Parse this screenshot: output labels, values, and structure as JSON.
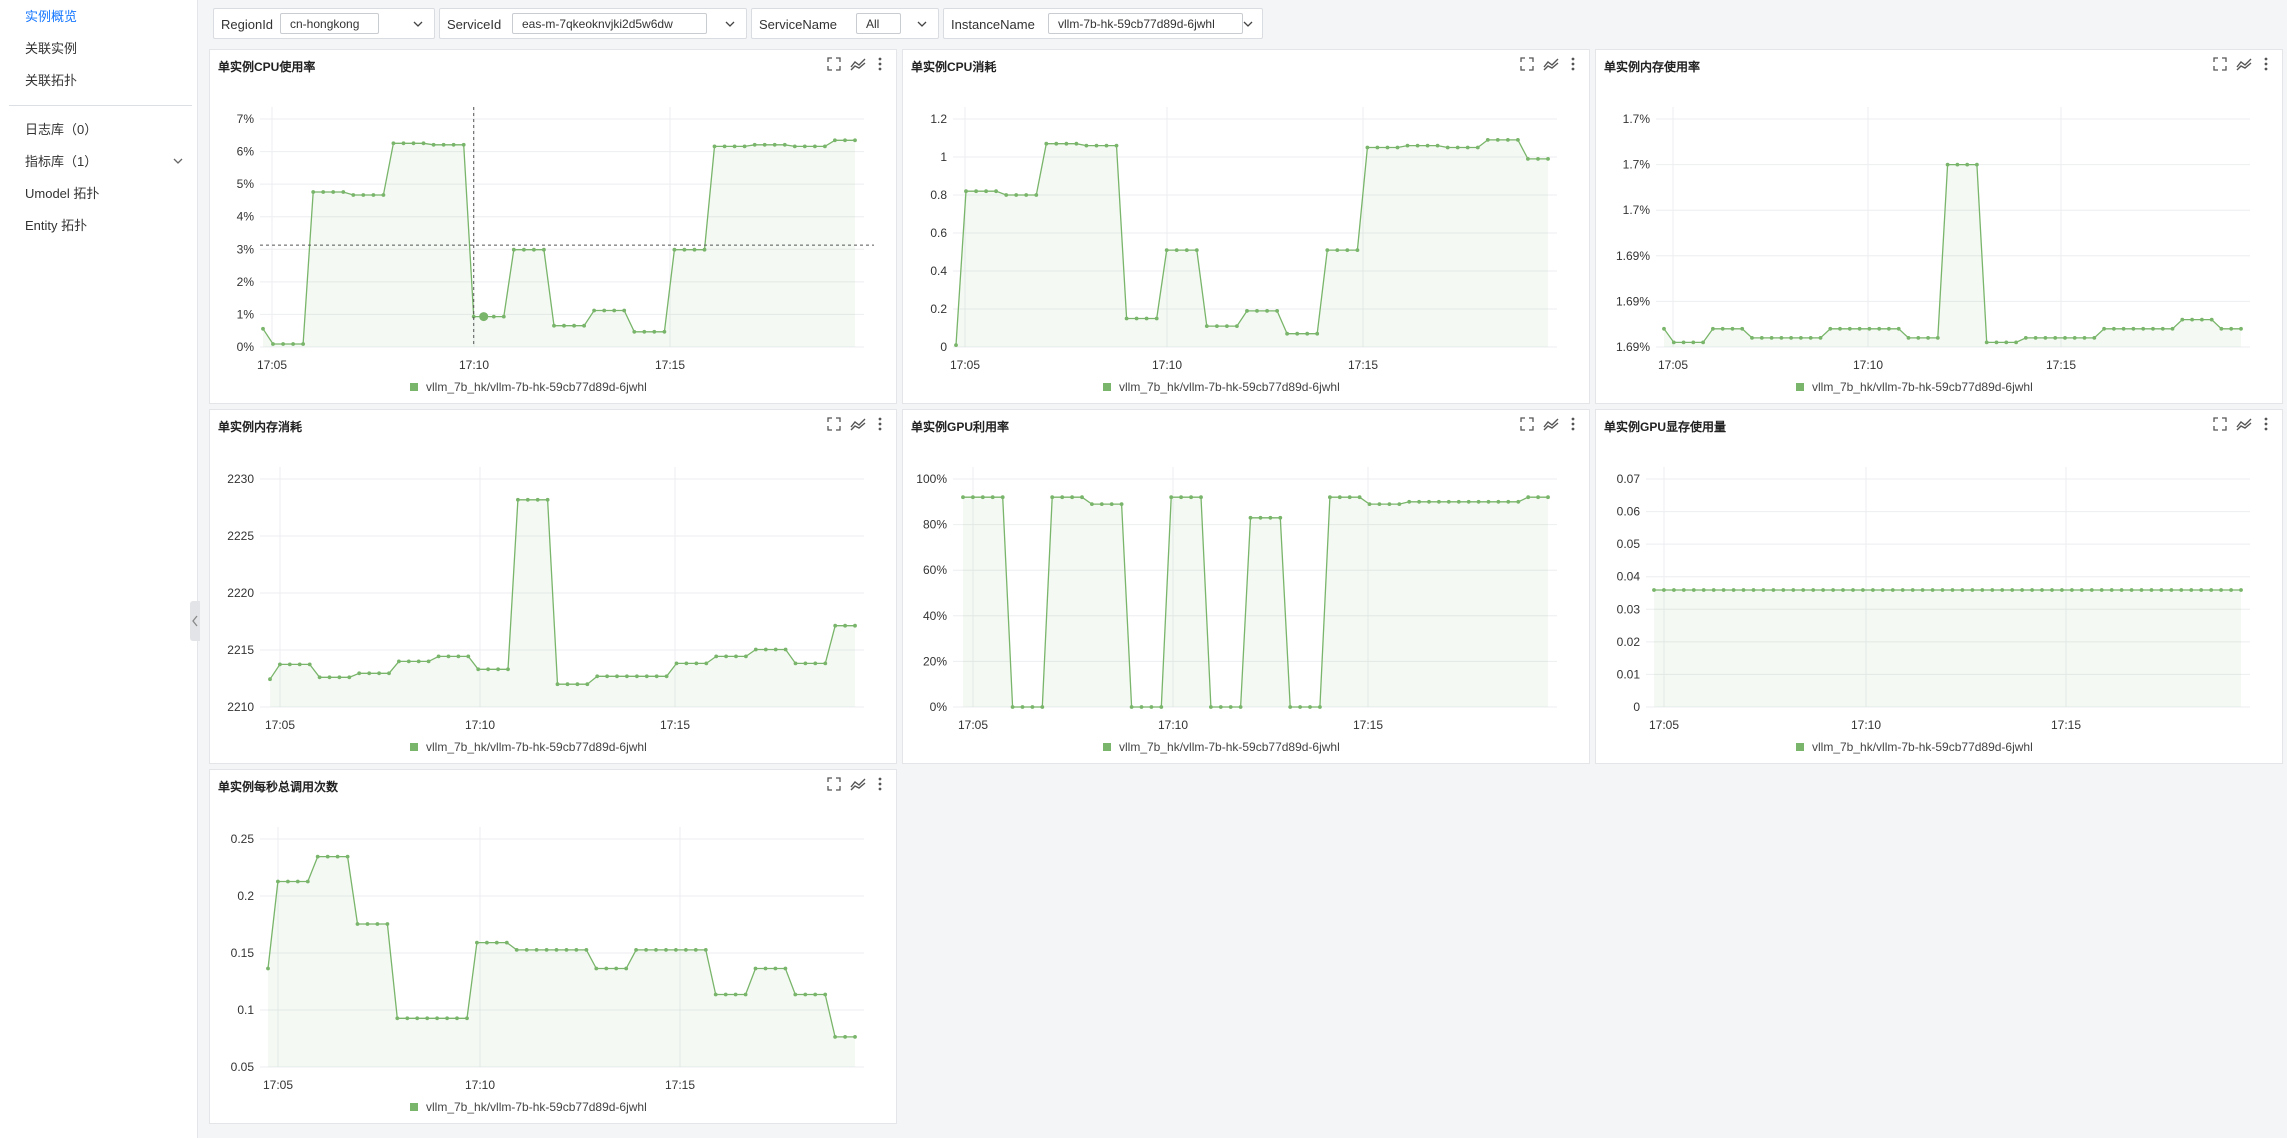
{
  "sidebar": {
    "items": [
      {
        "label": "实例概览",
        "active": true
      },
      {
        "label": "关联实例"
      },
      {
        "label": "关联拓扑"
      },
      {
        "label": "日志库（0）"
      },
      {
        "label": "指标库（1）",
        "expandable": true
      },
      {
        "label": "Umodel 拓扑"
      },
      {
        "label": "Entity 拓扑"
      }
    ]
  },
  "filters": {
    "region": {
      "label": "RegionId",
      "value": "cn-hongkong"
    },
    "service": {
      "label": "ServiceId",
      "value": "eas-m-7qkeoknvjki2d5w6dw"
    },
    "service_name": {
      "label": "ServiceName",
      "value": "All"
    },
    "instance": {
      "label": "InstanceName",
      "value": "vllm-7b-hk-59cb77d89d-6jwhl"
    }
  },
  "colors": {
    "series": "#79b56a",
    "accent": "#1677ff"
  },
  "icons": [
    "fullscreen-icon",
    "trend-icon",
    "more-icon",
    "chevron-down-icon",
    "collapse-left-icon"
  ],
  "panels": [
    {
      "title": "单实例CPU使用率",
      "legend": "vllm_7b_hk/vllm-7b-hk-59cb77d89d-6jwhl",
      "chart_data": {
        "type": "area",
        "y_ticks": [
          "0%",
          "1%",
          "2%",
          "3%",
          "4%",
          "5%",
          "6%",
          "7%"
        ],
        "x_ticks": [
          "17:05",
          "17:10",
          "17:15"
        ],
        "ylim": [
          0,
          7.5
        ],
        "y": [
          0.6,
          0.1,
          0.1,
          0.1,
          0.1,
          5.1,
          5.1,
          5.1,
          5.1,
          5.0,
          5.0,
          5.0,
          5.0,
          6.7,
          6.7,
          6.7,
          6.7,
          6.65,
          6.65,
          6.65,
          6.65,
          1.0,
          1.0,
          1.0,
          1.0,
          3.2,
          3.2,
          3.2,
          3.2,
          0.7,
          0.7,
          0.7,
          0.7,
          1.2,
          1.2,
          1.2,
          1.2,
          0.5,
          0.5,
          0.5,
          0.5,
          3.2,
          3.2,
          3.2,
          3.2,
          6.6,
          6.6,
          6.6,
          6.6,
          6.65,
          6.65,
          6.65,
          6.65,
          6.6,
          6.6,
          6.6,
          6.6,
          6.8,
          6.8,
          6.8
        ],
        "crosshair": {
          "index": 21,
          "y": 3.35
        }
      }
    },
    {
      "title": "单实例CPU消耗",
      "legend": "vllm_7b_hk/vllm-7b-hk-59cb77d89d-6jwhl",
      "chart_data": {
        "type": "area",
        "y_ticks": [
          "0",
          "0.2",
          "0.4",
          "0.6",
          "0.8",
          "1",
          "1.2"
        ],
        "x_ticks": [
          "17:05",
          "17:10",
          "17:15"
        ],
        "ylim": [
          0,
          1.2
        ],
        "y": [
          0.01,
          0.82,
          0.82,
          0.82,
          0.82,
          0.8,
          0.8,
          0.8,
          0.8,
          1.07,
          1.07,
          1.07,
          1.07,
          1.06,
          1.06,
          1.06,
          1.06,
          0.15,
          0.15,
          0.15,
          0.15,
          0.51,
          0.51,
          0.51,
          0.51,
          0.11,
          0.11,
          0.11,
          0.11,
          0.19,
          0.19,
          0.19,
          0.19,
          0.07,
          0.07,
          0.07,
          0.07,
          0.51,
          0.51,
          0.51,
          0.51,
          1.05,
          1.05,
          1.05,
          1.05,
          1.06,
          1.06,
          1.06,
          1.06,
          1.05,
          1.05,
          1.05,
          1.05,
          1.09,
          1.09,
          1.09,
          1.09,
          0.99,
          0.99,
          0.99
        ]
      }
    },
    {
      "title": "单实例内存使用率",
      "legend": "vllm_7b_hk/vllm-7b-hk-59cb77d89d-6jwhl",
      "chart_data": {
        "type": "area",
        "y_ticks": [
          "1.69%",
          "1.69%",
          "1.69%",
          "1.7%",
          "1.7%",
          "1.7%"
        ],
        "x_ticks": [
          "17:05",
          "17:10",
          "17:15"
        ],
        "ylim": [
          0,
          5
        ],
        "y": [
          0.4,
          0.1,
          0.1,
          0.1,
          0.1,
          0.4,
          0.4,
          0.4,
          0.4,
          0.2,
          0.2,
          0.2,
          0.2,
          0.2,
          0.2,
          0.2,
          0.2,
          0.4,
          0.4,
          0.4,
          0.4,
          0.4,
          0.4,
          0.4,
          0.4,
          0.2,
          0.2,
          0.2,
          0.2,
          4.0,
          4.0,
          4.0,
          4.0,
          0.1,
          0.1,
          0.1,
          0.1,
          0.2,
          0.2,
          0.2,
          0.2,
          0.2,
          0.2,
          0.2,
          0.2,
          0.4,
          0.4,
          0.4,
          0.4,
          0.4,
          0.4,
          0.4,
          0.4,
          0.6,
          0.6,
          0.6,
          0.6,
          0.4,
          0.4,
          0.4
        ]
      }
    },
    {
      "title": "单实例内存消耗",
      "legend": "vllm_7b_hk/vllm-7b-hk-59cb77d89d-6jwhl",
      "chart_data": {
        "type": "area",
        "y_ticks": [
          "2210",
          "2215",
          "2220",
          "2225",
          "2230"
        ],
        "x_ticks": [
          "17:05",
          "17:10",
          "17:15"
        ],
        "ylim": [
          2208,
          2231
        ],
        "y": [
          2210.8,
          2212.3,
          2212.3,
          2212.3,
          2212.3,
          2211.0,
          2211.0,
          2211.0,
          2211.0,
          2211.4,
          2211.4,
          2211.4,
          2211.4,
          2212.6,
          2212.6,
          2212.6,
          2212.6,
          2213.1,
          2213.1,
          2213.1,
          2213.1,
          2211.8,
          2211.8,
          2211.8,
          2211.8,
          2228.9,
          2228.9,
          2228.9,
          2228.9,
          2210.3,
          2210.3,
          2210.3,
          2210.3,
          2211.1,
          2211.1,
          2211.1,
          2211.1,
          2211.1,
          2211.1,
          2211.1,
          2211.1,
          2212.4,
          2212.4,
          2212.4,
          2212.4,
          2213.1,
          2213.1,
          2213.1,
          2213.1,
          2213.8,
          2213.8,
          2213.8,
          2213.8,
          2212.4,
          2212.4,
          2212.4,
          2212.4,
          2216.2,
          2216.2,
          2216.2
        ]
      }
    },
    {
      "title": "单实例GPU利用率",
      "legend": "vllm_7b_hk/vllm-7b-hk-59cb77d89d-6jwhl",
      "chart_data": {
        "type": "area",
        "y_ticks": [
          "0%",
          "20%",
          "40%",
          "60%",
          "80%",
          "100%"
        ],
        "x_ticks": [
          "17:05",
          "17:10",
          "17:15"
        ],
        "ylim": [
          0,
          100
        ],
        "y": [
          92,
          92,
          92,
          92,
          92,
          0,
          0,
          0,
          0,
          92,
          92,
          92,
          92,
          89,
          89,
          89,
          89,
          0,
          0,
          0,
          0,
          92,
          92,
          92,
          92,
          0,
          0,
          0,
          0,
          83,
          83,
          83,
          83,
          0,
          0,
          0,
          0,
          92,
          92,
          92,
          92,
          89,
          89,
          89,
          89,
          90,
          90,
          90,
          90,
          90,
          90,
          90,
          90,
          90,
          90,
          90,
          90,
          92,
          92,
          92
        ]
      }
    },
    {
      "title": "单实例GPU显存使用量",
      "legend": "vllm_7b_hk/vllm-7b-hk-59cb77d89d-6jwhl",
      "chart_data": {
        "type": "area",
        "y_ticks": [
          "0",
          "0.01",
          "0.02",
          "0.03",
          "0.04",
          "0.05",
          "0.06",
          "0.07"
        ],
        "x_ticks": [
          "17:05",
          "17:10",
          "17:15"
        ],
        "ylim": [
          0,
          0.075
        ],
        "y": [
          0.0385,
          0.0385,
          0.0385,
          0.0385,
          0.0385,
          0.0385,
          0.0385,
          0.0385,
          0.0385,
          0.0385,
          0.0385,
          0.0385,
          0.0385,
          0.0385,
          0.0385,
          0.0385,
          0.0385,
          0.0385,
          0.0385,
          0.0385,
          0.0385,
          0.0385,
          0.0385,
          0.0385,
          0.0385,
          0.0385,
          0.0385,
          0.0385,
          0.0385,
          0.0385,
          0.0385,
          0.0385,
          0.0385,
          0.0385,
          0.0385,
          0.0385,
          0.0385,
          0.0385,
          0.0385,
          0.0385,
          0.0385,
          0.0385,
          0.0385,
          0.0385,
          0.0385,
          0.0385,
          0.0385,
          0.0385,
          0.0385,
          0.0385,
          0.0385,
          0.0385,
          0.0385,
          0.0385,
          0.0385,
          0.0385,
          0.0385,
          0.0385,
          0.0385,
          0.0385
        ]
      }
    },
    {
      "title": "单实例每秒总调用次数",
      "legend": "vllm_7b_hk/vllm-7b-hk-59cb77d89d-6jwhl",
      "chart_data": {
        "type": "area",
        "y_ticks": [
          "0.05",
          "0.1",
          "0.15",
          "0.2",
          "0.25"
        ],
        "x_ticks": [
          "17:05",
          "17:10",
          "17:15"
        ],
        "ylim": [
          0.045,
          0.265
        ],
        "y": [
          0.14,
          0.224,
          0.224,
          0.224,
          0.224,
          0.248,
          0.248,
          0.248,
          0.248,
          0.183,
          0.183,
          0.183,
          0.183,
          0.092,
          0.092,
          0.092,
          0.092,
          0.092,
          0.092,
          0.092,
          0.092,
          0.165,
          0.165,
          0.165,
          0.165,
          0.158,
          0.158,
          0.158,
          0.158,
          0.158,
          0.158,
          0.158,
          0.158,
          0.14,
          0.14,
          0.14,
          0.14,
          0.158,
          0.158,
          0.158,
          0.158,
          0.158,
          0.158,
          0.158,
          0.158,
          0.115,
          0.115,
          0.115,
          0.115,
          0.14,
          0.14,
          0.14,
          0.14,
          0.115,
          0.115,
          0.115,
          0.115,
          0.074,
          0.074,
          0.074
        ]
      }
    }
  ]
}
